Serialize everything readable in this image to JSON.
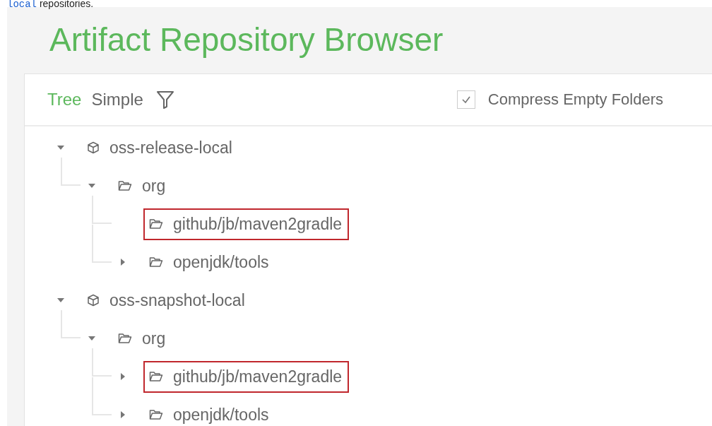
{
  "intro": {
    "code": "local",
    "text": " repositories."
  },
  "title": "Artifact Repository Browser",
  "view_tabs": [
    {
      "label": "Tree",
      "selected": true
    },
    {
      "label": "Simple",
      "selected": false
    }
  ],
  "compress_empty_folders": {
    "label": "Compress Empty Folders",
    "checked": true
  },
  "tree": [
    {
      "name": "oss-release-local",
      "kind": "repository",
      "expandable": true,
      "expanded": true,
      "highlighted": false,
      "children": [
        {
          "name": "org",
          "kind": "folder",
          "expandable": true,
          "expanded": true,
          "highlighted": false,
          "children": [
            {
              "name": "github/jb/maven2gradle",
              "kind": "folder",
              "expandable": false,
              "highlighted": true
            },
            {
              "name": "openjdk/tools",
              "kind": "folder",
              "expandable": true,
              "expanded": false,
              "highlighted": false
            }
          ]
        }
      ]
    },
    {
      "name": "oss-snapshot-local",
      "kind": "repository",
      "expandable": true,
      "expanded": true,
      "highlighted": false,
      "children": [
        {
          "name": "org",
          "kind": "folder",
          "expandable": true,
          "expanded": true,
          "highlighted": false,
          "children": [
            {
              "name": "github/jb/maven2gradle",
              "kind": "folder",
              "expandable": true,
              "expanded": false,
              "highlighted": true
            },
            {
              "name": "openjdk/tools",
              "kind": "folder",
              "expandable": true,
              "expanded": false,
              "highlighted": false
            }
          ]
        }
      ]
    }
  ]
}
